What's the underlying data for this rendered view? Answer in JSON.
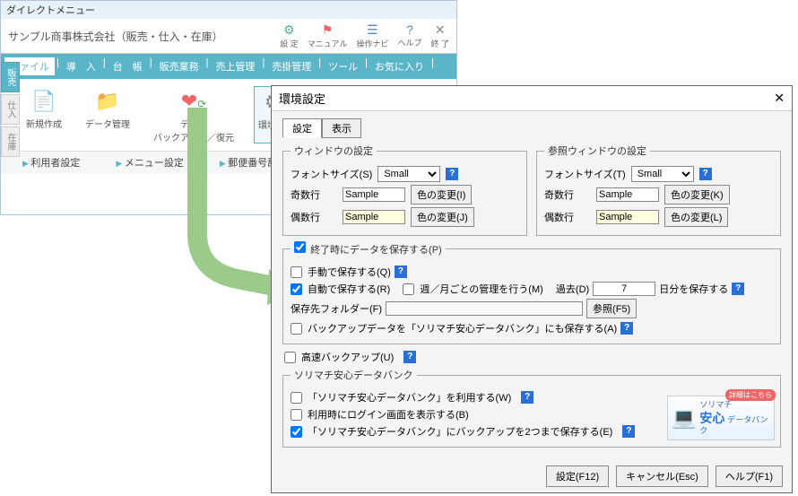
{
  "main": {
    "title": "ダイレクトメニュー",
    "company": "サンプル商事株式会社（販売・仕入・在庫）",
    "tool_labels": {
      "settings": "設 定",
      "manual": "マニュアル",
      "navi": "操作ナビ",
      "help": "ヘルプ",
      "exit": "終 了"
    },
    "tabs": [
      "ファイル",
      "導　入",
      "台　帳",
      "販売業務",
      "売上管理",
      "売掛管理",
      "ツール",
      "お気に入り"
    ],
    "side_tabs": [
      "販売",
      "仕入",
      "在庫"
    ],
    "ribbon": [
      {
        "label": "新規作成"
      },
      {
        "label": "データ管理"
      },
      {
        "label": "データ\nバックアップ／復元"
      },
      {
        "label": "環境設定"
      }
    ],
    "sub": [
      "利用者設定",
      "メニュー設定",
      "郵便番号辞書修正"
    ]
  },
  "dialog": {
    "title": "環境設定",
    "tabs": [
      "設定",
      "表示"
    ],
    "win": {
      "legend": "ウィンドウの設定",
      "font_label": "フォントサイズ(S)",
      "font_value": "Small",
      "odd_label": "奇数行",
      "odd_value": "Sample",
      "odd_btn": "色の変更(I)",
      "even_label": "偶数行",
      "even_value": "Sample",
      "even_btn": "色の変更(J)"
    },
    "refwin": {
      "legend": "参照ウィンドウの設定",
      "font_label": "フォントサイズ(T)",
      "font_value": "Small",
      "odd_label": "奇数行",
      "odd_value": "Sample",
      "odd_btn": "色の変更(K)",
      "even_label": "偶数行",
      "even_value": "Sample",
      "even_btn": "色の変更(L)"
    },
    "save": {
      "legend": "終了時にデータを保存する(P)",
      "manual": "手動で保存する(Q)",
      "auto": "自動で保存する(R)",
      "weekly": "週／月ごとの管理を行う(M)",
      "past_label": "過去(D)",
      "days": "7",
      "days_suffix": "日分を保存する",
      "folder_label": "保存先フォルダー(F)",
      "folder_value": "",
      "browse": "参照(F5)",
      "databank_also": "バックアップデータを「ソリマチ安心データバンク」にも保存する(A)"
    },
    "fast_backup": "高速バックアップ(U)",
    "databank": {
      "legend": "ソリマチ安心データバンク",
      "use": "「ソリマチ安心データバンク」を利用する(W)",
      "login": "利用時にログイン画面を表示する(B)",
      "limit2": "「ソリマチ安心データバンク」にバックアップを2つまで保存する(E)",
      "banner_badge": "詳細はこちら",
      "banner_line1": "ソリマチ",
      "banner_line2": "安心",
      "banner_line3": "データバンク"
    },
    "footer": {
      "ok": "設定(F12)",
      "cancel": "キャンセル(Esc)",
      "help": "ヘルプ(F1)"
    }
  }
}
